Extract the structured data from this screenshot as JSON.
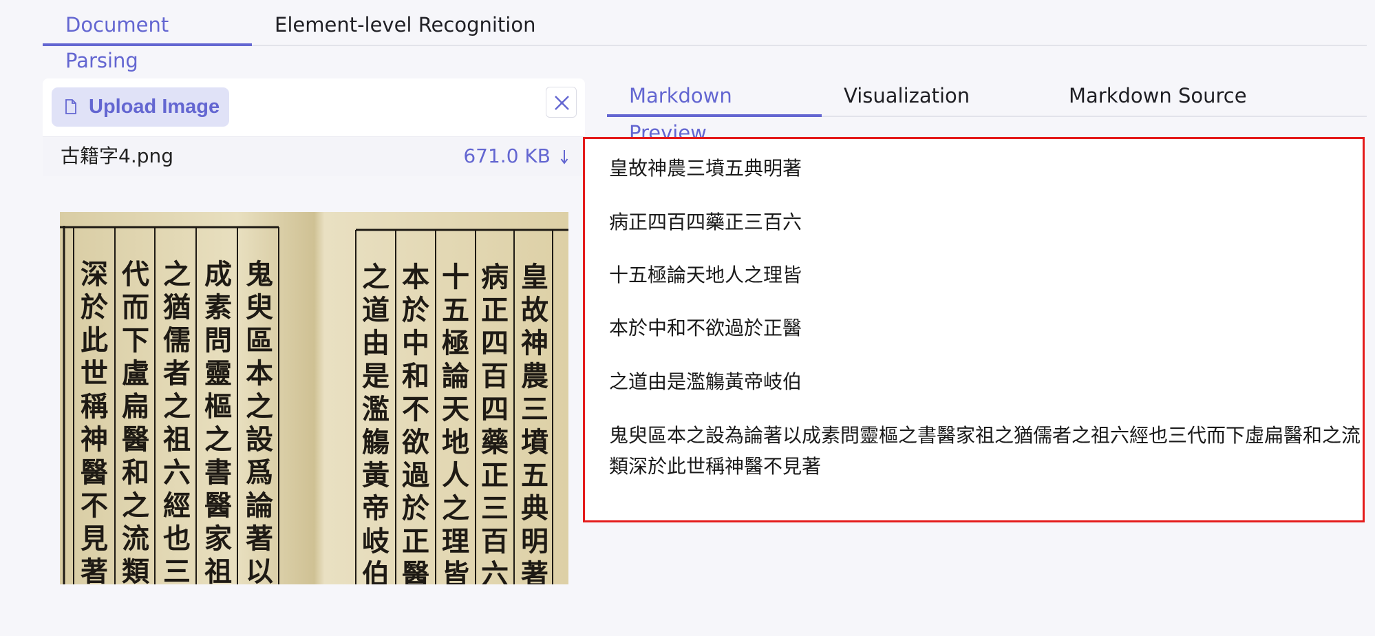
{
  "top_tabs": {
    "document_parsing": "Document Parsing",
    "element_recognition": "Element-level Recognition"
  },
  "upload": {
    "button_label": "Upload Image",
    "file_name": "古籍字4.png",
    "file_size": "671.0 KB"
  },
  "preview_image": {
    "columns_right_page": [
      "皇故神農三墳五典明著",
      "病正四百四藥正三百六",
      "十五極論天地人之理皆",
      "本於中和不欲過於正醫",
      "之道由是濫觴黃帝岐伯"
    ],
    "columns_left_page": [
      "鬼臾區本之設爲論著以",
      "成素問靈樞之書醫家祖",
      "之猶儒者之祖六經也三",
      "代而下盧扁醫和之流類",
      "深於此世稱神醫不見著"
    ]
  },
  "right_tabs": {
    "markdown_preview": "Markdown Preview",
    "visualization": "Visualization",
    "markdown_source": "Markdown Source"
  },
  "markdown": {
    "paragraphs": [
      "皇故神農三墳五典明著",
      "病正四百四藥正三百六",
      "十五極論天地人之理皆",
      "本於中和不欲過於正醫",
      "之道由是濫觴黃帝岐伯",
      "鬼臾區本之設為論著以成素問靈樞之書醫家祖之猶儒者之祖六經也三代而下虛扁醫和之流類深於此世稱神醫不見著"
    ]
  },
  "colors": {
    "accent": "#6366d1",
    "highlight_border": "#e41b1b",
    "paper": "#e6dcbb",
    "ink": "#1e1a14"
  }
}
